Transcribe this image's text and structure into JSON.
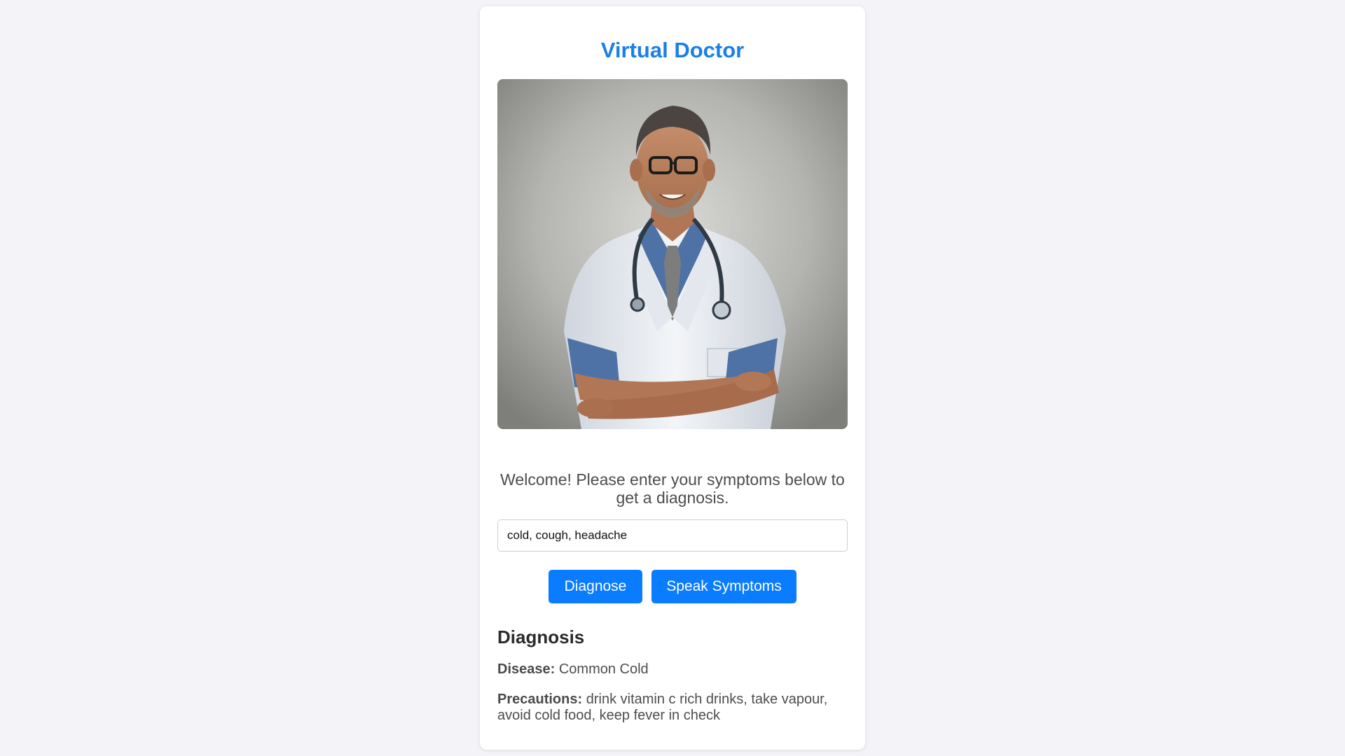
{
  "app": {
    "title": "Virtual Doctor"
  },
  "hero_image": {
    "icon": "doctor-portrait",
    "colors": {
      "background": "#a9a9a7",
      "coat": "#eef1f5",
      "shirt": "#4f72a6",
      "tie": "#7d7d7d",
      "skin": "#b9805e",
      "hair": "#4b4440"
    }
  },
  "intro": {
    "welcome_text": "Welcome! Please enter your symptoms below to get a diagnosis."
  },
  "symptom_input": {
    "value": "cold, cough, headache"
  },
  "actions": {
    "diagnose_label": "Diagnose",
    "speak_label": "Speak Symptoms"
  },
  "diagnosis": {
    "heading": "Diagnosis",
    "disease_label": "Disease:",
    "disease_value": "Common Cold",
    "precautions_label": "Precautions:",
    "precautions_value": "drink vitamin c rich drinks, take vapour, avoid cold food, keep fever in check"
  },
  "theme": {
    "accent": "#0a7cff",
    "title_color": "#1a7fe8",
    "page_background": "#f4f4f8"
  }
}
